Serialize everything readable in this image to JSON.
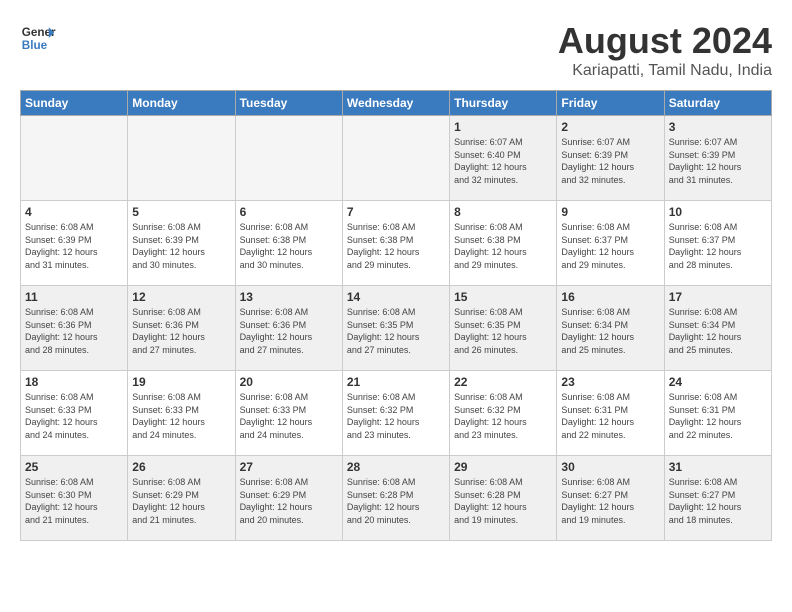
{
  "header": {
    "logo_line1": "General",
    "logo_line2": "Blue",
    "month": "August 2024",
    "location": "Kariapatti, Tamil Nadu, India"
  },
  "weekdays": [
    "Sunday",
    "Monday",
    "Tuesday",
    "Wednesday",
    "Thursday",
    "Friday",
    "Saturday"
  ],
  "weeks": [
    [
      {
        "day": "",
        "detail": "",
        "empty": true
      },
      {
        "day": "",
        "detail": "",
        "empty": true
      },
      {
        "day": "",
        "detail": "",
        "empty": true
      },
      {
        "day": "",
        "detail": "",
        "empty": true
      },
      {
        "day": "1",
        "detail": "Sunrise: 6:07 AM\nSunset: 6:40 PM\nDaylight: 12 hours\nand 32 minutes."
      },
      {
        "day": "2",
        "detail": "Sunrise: 6:07 AM\nSunset: 6:39 PM\nDaylight: 12 hours\nand 32 minutes."
      },
      {
        "day": "3",
        "detail": "Sunrise: 6:07 AM\nSunset: 6:39 PM\nDaylight: 12 hours\nand 31 minutes."
      }
    ],
    [
      {
        "day": "4",
        "detail": "Sunrise: 6:08 AM\nSunset: 6:39 PM\nDaylight: 12 hours\nand 31 minutes."
      },
      {
        "day": "5",
        "detail": "Sunrise: 6:08 AM\nSunset: 6:39 PM\nDaylight: 12 hours\nand 30 minutes."
      },
      {
        "day": "6",
        "detail": "Sunrise: 6:08 AM\nSunset: 6:38 PM\nDaylight: 12 hours\nand 30 minutes."
      },
      {
        "day": "7",
        "detail": "Sunrise: 6:08 AM\nSunset: 6:38 PM\nDaylight: 12 hours\nand 29 minutes."
      },
      {
        "day": "8",
        "detail": "Sunrise: 6:08 AM\nSunset: 6:38 PM\nDaylight: 12 hours\nand 29 minutes."
      },
      {
        "day": "9",
        "detail": "Sunrise: 6:08 AM\nSunset: 6:37 PM\nDaylight: 12 hours\nand 29 minutes."
      },
      {
        "day": "10",
        "detail": "Sunrise: 6:08 AM\nSunset: 6:37 PM\nDaylight: 12 hours\nand 28 minutes."
      }
    ],
    [
      {
        "day": "11",
        "detail": "Sunrise: 6:08 AM\nSunset: 6:36 PM\nDaylight: 12 hours\nand 28 minutes."
      },
      {
        "day": "12",
        "detail": "Sunrise: 6:08 AM\nSunset: 6:36 PM\nDaylight: 12 hours\nand 27 minutes."
      },
      {
        "day": "13",
        "detail": "Sunrise: 6:08 AM\nSunset: 6:36 PM\nDaylight: 12 hours\nand 27 minutes."
      },
      {
        "day": "14",
        "detail": "Sunrise: 6:08 AM\nSunset: 6:35 PM\nDaylight: 12 hours\nand 27 minutes."
      },
      {
        "day": "15",
        "detail": "Sunrise: 6:08 AM\nSunset: 6:35 PM\nDaylight: 12 hours\nand 26 minutes."
      },
      {
        "day": "16",
        "detail": "Sunrise: 6:08 AM\nSunset: 6:34 PM\nDaylight: 12 hours\nand 25 minutes."
      },
      {
        "day": "17",
        "detail": "Sunrise: 6:08 AM\nSunset: 6:34 PM\nDaylight: 12 hours\nand 25 minutes."
      }
    ],
    [
      {
        "day": "18",
        "detail": "Sunrise: 6:08 AM\nSunset: 6:33 PM\nDaylight: 12 hours\nand 24 minutes."
      },
      {
        "day": "19",
        "detail": "Sunrise: 6:08 AM\nSunset: 6:33 PM\nDaylight: 12 hours\nand 24 minutes."
      },
      {
        "day": "20",
        "detail": "Sunrise: 6:08 AM\nSunset: 6:33 PM\nDaylight: 12 hours\nand 24 minutes."
      },
      {
        "day": "21",
        "detail": "Sunrise: 6:08 AM\nSunset: 6:32 PM\nDaylight: 12 hours\nand 23 minutes."
      },
      {
        "day": "22",
        "detail": "Sunrise: 6:08 AM\nSunset: 6:32 PM\nDaylight: 12 hours\nand 23 minutes."
      },
      {
        "day": "23",
        "detail": "Sunrise: 6:08 AM\nSunset: 6:31 PM\nDaylight: 12 hours\nand 22 minutes."
      },
      {
        "day": "24",
        "detail": "Sunrise: 6:08 AM\nSunset: 6:31 PM\nDaylight: 12 hours\nand 22 minutes."
      }
    ],
    [
      {
        "day": "25",
        "detail": "Sunrise: 6:08 AM\nSunset: 6:30 PM\nDaylight: 12 hours\nand 21 minutes."
      },
      {
        "day": "26",
        "detail": "Sunrise: 6:08 AM\nSunset: 6:29 PM\nDaylight: 12 hours\nand 21 minutes."
      },
      {
        "day": "27",
        "detail": "Sunrise: 6:08 AM\nSunset: 6:29 PM\nDaylight: 12 hours\nand 20 minutes."
      },
      {
        "day": "28",
        "detail": "Sunrise: 6:08 AM\nSunset: 6:28 PM\nDaylight: 12 hours\nand 20 minutes."
      },
      {
        "day": "29",
        "detail": "Sunrise: 6:08 AM\nSunset: 6:28 PM\nDaylight: 12 hours\nand 19 minutes."
      },
      {
        "day": "30",
        "detail": "Sunrise: 6:08 AM\nSunset: 6:27 PM\nDaylight: 12 hours\nand 19 minutes."
      },
      {
        "day": "31",
        "detail": "Sunrise: 6:08 AM\nSunset: 6:27 PM\nDaylight: 12 hours\nand 18 minutes."
      }
    ]
  ]
}
